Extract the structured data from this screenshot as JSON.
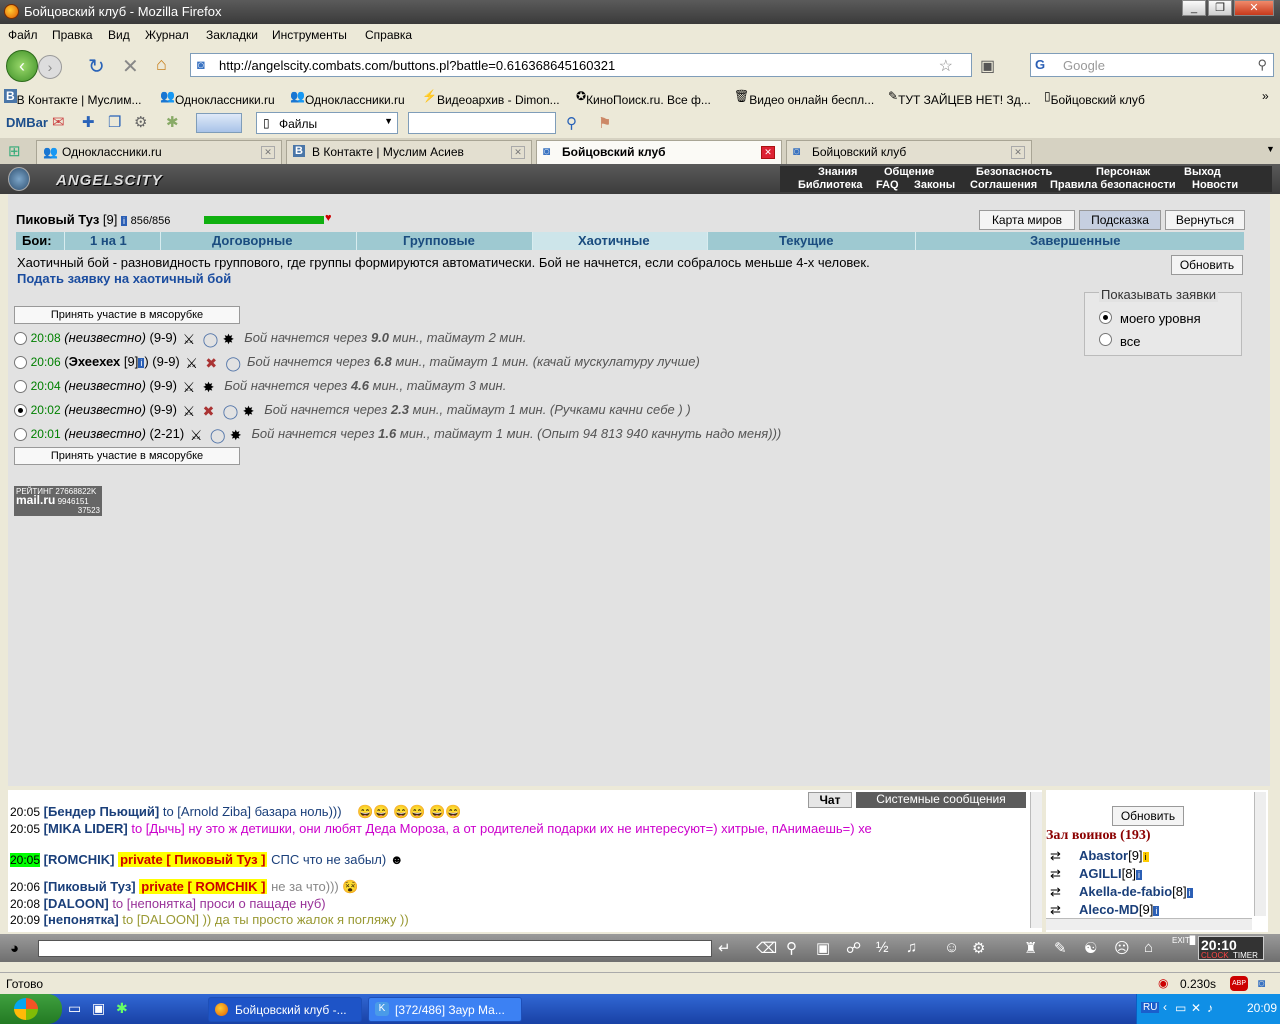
{
  "window": {
    "title": "Бойцовский клуб - Mozilla Firefox"
  },
  "menu": [
    "Файл",
    "Правка",
    "Вид",
    "Журнал",
    "Закладки",
    "Инструменты",
    "Справка"
  ],
  "nav": {
    "url": "http://angelscity.combats.com/buttons.pl?battle=0.616368645160321",
    "search_placeholder": "Google"
  },
  "bookmarks": [
    "В Контакте | Муслим...",
    "Одноклассники.ru",
    "Одноклассники.ru",
    "Видеоархив - Dimon...",
    "КиноПоиск.ru. Все ф...",
    "Видео онлайн беспл...",
    "ТУТ ЗАЙЦЕВ НЕТ! Зд...",
    "Бойцовский клуб"
  ],
  "dmbar": {
    "label": "DMBar",
    "files": "Файлы"
  },
  "tabs": [
    "Одноклассники.ru",
    "В Контакте | Муслим Асиев",
    "Бойцовский клуб",
    "Бойцовский клуб"
  ],
  "game": {
    "logo": "ANGELSCITY",
    "nav_top": [
      "Знания",
      "Общение",
      "Безопасность",
      "Персонаж",
      "Выход"
    ],
    "nav_bottom": [
      "Библиотека",
      "FAQ",
      "Законы",
      "Соглашения",
      "Правила безопасности",
      "Новости"
    ],
    "player": {
      "name": "Пиковый Туз",
      "level": "[9]",
      "hp": "856/856",
      "hp_fraction": 1.0
    },
    "top_buttons": [
      "Карта миров",
      "Подсказка",
      "Вернуться"
    ],
    "battles_label": "Бои:",
    "battle_tabs": [
      "1 на 1",
      "Договорные",
      "Групповые",
      "Хаотичные",
      "Текущие",
      "Завершенные"
    ],
    "description": "Хаотичный бой - разновидность группового, где группы формируются автоматически. Бой не начнется, если собралось меньше 4-х человек.",
    "apply_link": "Подать заявку на хаотичный бой",
    "refresh": "Обновить",
    "join_button": "Принять участие в мясорубке",
    "filter": {
      "title": "Показывать заявки",
      "opt1": "моего уровня",
      "opt2": "все"
    },
    "rows": [
      {
        "time": "20:08",
        "who": "(неизвестно)",
        "lvl": "(9-9)",
        "text": "Бой начнется через",
        "min": "9.0",
        "rest": "мин., таймаут 2 мин."
      },
      {
        "time": "20:06",
        "who": "Эхеехех",
        "whoLvl": "[9]",
        "lvl": ") (9-9)",
        "text": "Бой начнется через",
        "min": "6.8",
        "rest": "мин., таймаут 1 мин. (качай мускулатуру лучше)"
      },
      {
        "time": "20:04",
        "who": "(неизвестно)",
        "lvl": "(9-9)",
        "text": "Бой начнется через",
        "min": "4.6",
        "rest": "мин., таймаут 3 мин."
      },
      {
        "time": "20:02",
        "who": "(неизвестно)",
        "lvl": "(9-9)",
        "text": "Бой начнется через",
        "min": "2.3",
        "rest": "мин., таймаут 1 мин. (Ручками качни себе ) )"
      },
      {
        "time": "20:01",
        "who": "(неизвестно)",
        "lvl": "(2-21)",
        "text": "Бой начнется через",
        "min": "1.6",
        "rest": "мин., таймаут 1 мин. (Опыт 94 813 940 качнуть надо меня)))"
      }
    ],
    "rating": {
      "line1": "РЕЙТИНГ 27668822K",
      "brand": "mail.ru",
      "n1": "9946151",
      "n2": "37523"
    }
  },
  "chat": {
    "tabs": [
      "Чат",
      "Системные сообщения"
    ],
    "lines": [
      {
        "t": "20:05",
        "nick": "Бендер Пьющий",
        "to": "to [Arnold Ziba]",
        "msg": "базара ноль)))"
      },
      {
        "t": "20:05",
        "nick": "MIKA LIDER",
        "to": "to [Дычь]",
        "msg": "ну это ж детишки, они любят Деда Мороза, а от родителей подарки их не интересуют=) хитрые, пАнимаешь=) хе"
      },
      {
        "t": "20:05",
        "nick": "ROMCHIK",
        "to": "private [ Пиковый Туз ]",
        "msg": "СПС что не забыл)"
      },
      {
        "t": "20:06",
        "nick": "Пиковый Туз",
        "to": "private [ ROMCHIK ]",
        "msg": "не за что)))"
      },
      {
        "t": "20:08",
        "nick": "DALOON",
        "to": "to [непонятка]",
        "msg": "проси о пащаде нуб)"
      },
      {
        "t": "20:09",
        "nick": "непонятка",
        "to": "to [DALOON]",
        "msg": ")) да ты просто жалок я погляжу ))"
      }
    ],
    "refresh": "Обновить",
    "hall": "Зал воинов (193)",
    "users": [
      {
        "name": "Abastor",
        "lvl": "[9]"
      },
      {
        "name": "AGILLI",
        "lvl": "[8]"
      },
      {
        "name": "Akella-de-fabio",
        "lvl": "[8]"
      },
      {
        "name": "Aleco-MD",
        "lvl": "[9]"
      }
    ],
    "clock": "20:10",
    "clock_labels": [
      "CLOCK",
      "TIMER"
    ]
  },
  "status": {
    "text": "Готово",
    "time": "0.230s"
  },
  "taskbar": {
    "tasks": [
      "Бойцовский клуб -...",
      "[372/486] Заур Ма..."
    ],
    "lang": "RU",
    "clock": "20:09"
  }
}
